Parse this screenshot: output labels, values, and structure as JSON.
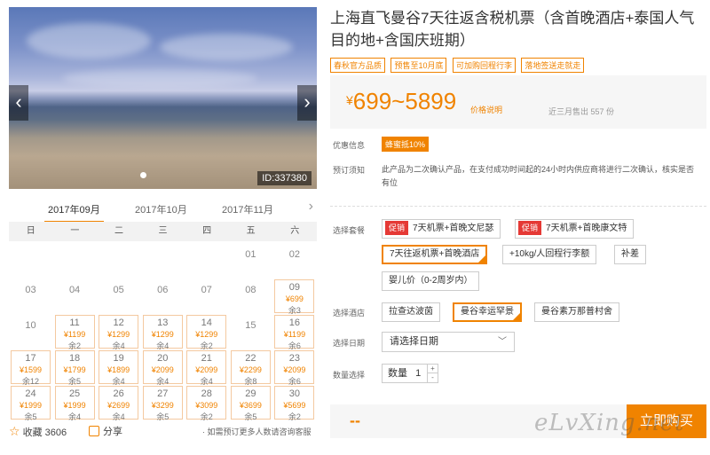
{
  "product": {
    "title": "上海直飞曼谷7天往返含税机票（含首晚酒店+泰国人气目的地+含国庆班期）",
    "tags": [
      "春秋官方品质",
      "预售至10月底",
      "可加购回程行李",
      "落地签送走就走"
    ],
    "price_range": "699~5899",
    "currency": "¥",
    "price_explain": "价格说明",
    "sold_text": "近三月售出 557 份"
  },
  "gallery": {
    "id_label": "ID:337380",
    "prev_icon": "‹",
    "next_icon": "›"
  },
  "calendar": {
    "months": [
      "2017年09月",
      "2017年10月",
      "2017年11月"
    ],
    "active_month": 0,
    "weekdays": [
      "日",
      "一",
      "二",
      "三",
      "四",
      "五",
      "六"
    ],
    "cells": [
      {
        "day": "01",
        "col": 5,
        "row": 0
      },
      {
        "day": "02",
        "col": 6,
        "row": 0
      },
      {
        "day": "03",
        "col": 0,
        "row": 1
      },
      {
        "day": "04",
        "col": 1,
        "row": 1
      },
      {
        "day": "05",
        "col": 2,
        "row": 1
      },
      {
        "day": "06",
        "col": 3,
        "row": 1
      },
      {
        "day": "07",
        "col": 4,
        "row": 1
      },
      {
        "day": "08",
        "col": 5,
        "row": 1
      },
      {
        "day": "09",
        "col": 6,
        "row": 1,
        "price": "¥699",
        "stock": "余3"
      },
      {
        "day": "10",
        "col": 0,
        "row": 2
      },
      {
        "day": "11",
        "col": 1,
        "row": 2,
        "price": "¥1199",
        "stock": "余2"
      },
      {
        "day": "12",
        "col": 2,
        "row": 2,
        "price": "¥1299",
        "stock": "余4"
      },
      {
        "day": "13",
        "col": 3,
        "row": 2,
        "price": "¥1299",
        "stock": "余4"
      },
      {
        "day": "14",
        "col": 4,
        "row": 2,
        "price": "¥1299",
        "stock": "余2"
      },
      {
        "day": "15",
        "col": 5,
        "row": 2
      },
      {
        "day": "16",
        "col": 6,
        "row": 2,
        "price": "¥1199",
        "stock": "余6"
      },
      {
        "day": "17",
        "col": 0,
        "row": 3,
        "price": "¥1599",
        "stock": "余12"
      },
      {
        "day": "18",
        "col": 1,
        "row": 3,
        "price": "¥1799",
        "stock": "余5"
      },
      {
        "day": "19",
        "col": 2,
        "row": 3,
        "price": "¥1899",
        "stock": "余4"
      },
      {
        "day": "20",
        "col": 3,
        "row": 3,
        "price": "¥2099",
        "stock": "余4"
      },
      {
        "day": "21",
        "col": 4,
        "row": 3,
        "price": "¥2099",
        "stock": "余4"
      },
      {
        "day": "22",
        "col": 5,
        "row": 3,
        "price": "¥2299",
        "stock": "余8"
      },
      {
        "day": "23",
        "col": 6,
        "row": 3,
        "price": "¥2099",
        "stock": "余6"
      },
      {
        "day": "24",
        "col": 0,
        "row": 4,
        "price": "¥1999",
        "stock": "余5"
      },
      {
        "day": "25",
        "col": 1,
        "row": 4,
        "price": "¥1999",
        "stock": "余4"
      },
      {
        "day": "26",
        "col": 2,
        "row": 4,
        "price": "¥2699",
        "stock": "余4"
      },
      {
        "day": "27",
        "col": 3,
        "row": 4,
        "price": "¥3299",
        "stock": "余5"
      },
      {
        "day": "28",
        "col": 4,
        "row": 4,
        "price": "¥3099",
        "stock": "余2"
      },
      {
        "day": "29",
        "col": 5,
        "row": 4,
        "price": "¥3699",
        "stock": "余5"
      },
      {
        "day": "30",
        "col": 6,
        "row": 4,
        "price": "¥5699",
        "stock": "余2"
      }
    ]
  },
  "actions": {
    "favorite_label": "收藏 3606",
    "share_label": "分享",
    "note": "· 如需预订更多人数请咨询客服"
  },
  "info": {
    "promo_label": "优惠信息",
    "promo_badge": "蜂蜜抵10%",
    "notice_label": "预订须知",
    "notice_text": "此产品为二次确认产品，在支付成功时间起的24小时内供应商将进行二次确认，核实是否有位"
  },
  "packages": {
    "label": "选择套餐",
    "promo_tag": "促销",
    "items": [
      {
        "label": "7天机票+首晚文尼瑟",
        "promo": true,
        "selected": false
      },
      {
        "label": "7天机票+首晚康文特",
        "promo": true,
        "selected": false
      },
      {
        "label": "7天往返机票+首晚酒店",
        "promo": false,
        "selected": true
      },
      {
        "label": "+10kg/人回程行李额",
        "promo": false,
        "selected": false
      },
      {
        "label": "补差",
        "promo": false,
        "selected": false
      },
      {
        "label": "婴儿价（0-2周岁内）",
        "promo": false,
        "selected": false
      }
    ]
  },
  "hotels": {
    "label": "选择酒店",
    "items": [
      {
        "label": "拉查达波茵",
        "selected": false
      },
      {
        "label": "曼谷幸运罕景",
        "selected": true
      },
      {
        "label": "曼谷素万那普村舍",
        "selected": false
      }
    ]
  },
  "date": {
    "label": "选择日期",
    "placeholder": "请选择日期"
  },
  "quantity": {
    "label": "数量选择",
    "field_label": "数量",
    "value": "1",
    "plus": "+",
    "minus": "-"
  },
  "bottom": {
    "price_placeholder": "--",
    "buy_label": "立即购买",
    "watermark": "eLvXing.net"
  },
  "colors": {
    "accent": "#f08300",
    "promo_red": "#e53935"
  }
}
